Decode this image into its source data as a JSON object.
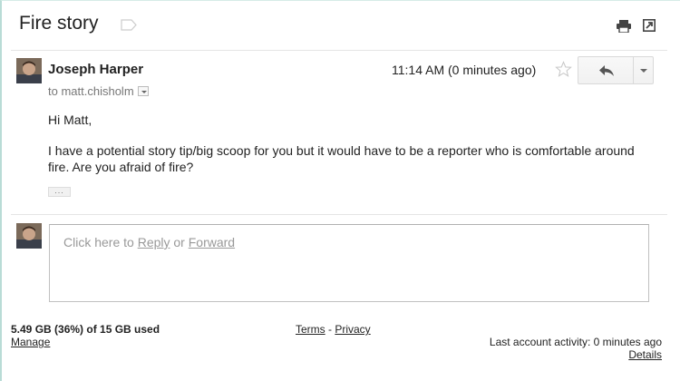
{
  "thread": {
    "subject": "Fire story",
    "label_icon": "label-icon",
    "print_icon": "print-icon",
    "new_window_icon": "new-window-icon"
  },
  "message": {
    "sender_name": "Joseph Harper",
    "to_line": "to matt.chisholm",
    "timestamp": "11:14 AM (0 minutes ago)",
    "star_icon": "star-icon",
    "reply_icon": "reply-arrow-icon",
    "more_icon": "chevron-down-icon",
    "greeting": "Hi Matt,",
    "body": "I have a potential story tip/big scoop for you but it would have to be a reporter who is comfortable around fire. Are you afraid of fire?",
    "trimmed_content_label": "..."
  },
  "reply_box": {
    "prefix": "Click here to ",
    "reply_link": "Reply",
    "or_text": " or ",
    "forward_link": "Forward"
  },
  "footer": {
    "storage": "5.49 GB (36%) of 15 GB used",
    "manage": "Manage",
    "terms": "Terms",
    "separator": " - ",
    "privacy": "Privacy",
    "last_activity": "Last account activity: 0 minutes ago",
    "details": "Details"
  },
  "colors": {
    "frame_border": "#b9dcd6",
    "text": "#222222",
    "muted": "#777777",
    "divider": "#e5e5e5"
  }
}
